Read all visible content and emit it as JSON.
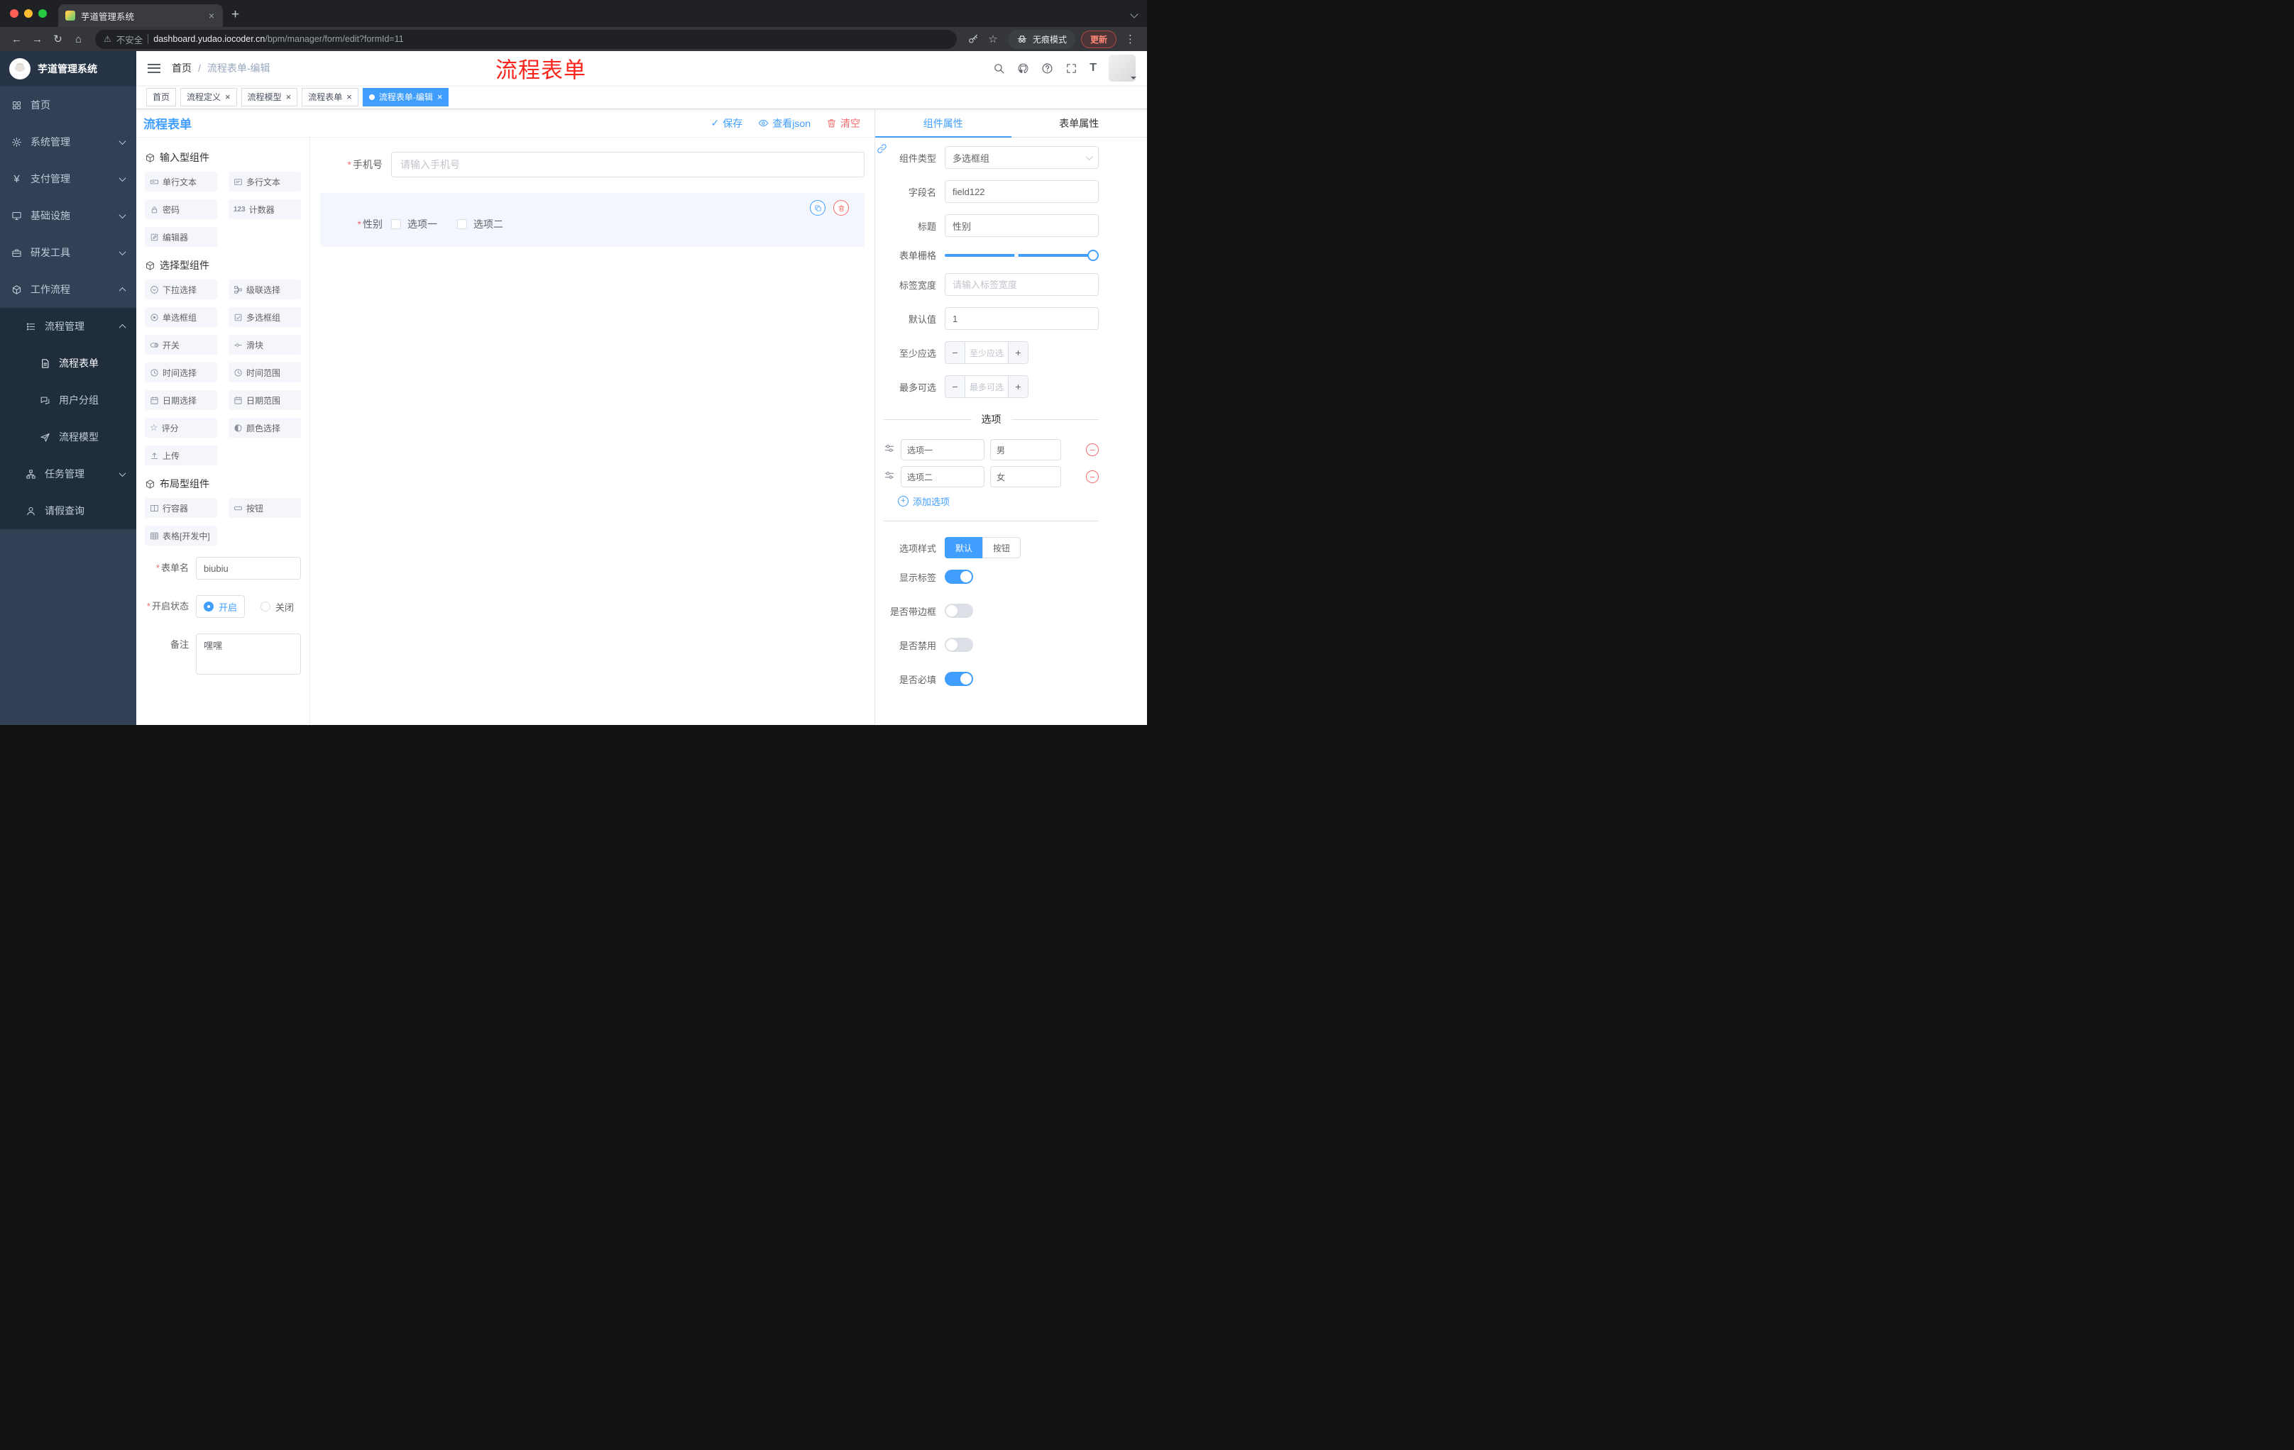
{
  "colors": {
    "accent": "#409eff",
    "danger": "#f56c6c",
    "sidebar_bg": "#304156",
    "sidebar_submenu_bg": "#1f2d3d",
    "annotation": "#fa251c"
  },
  "icons": {
    "close": "×",
    "new_tab": "+",
    "back": "←",
    "forward": "→",
    "reload": "↻",
    "home": "⌂",
    "warning": "⚠",
    "star": "☆",
    "menu_dots": "⋮",
    "check": "✓",
    "breadcrumb_separator": "/",
    "required_mark": "*",
    "minus": "−",
    "plus": "+",
    "yen": "¥",
    "counter": "123",
    "rate_star": "☆",
    "font_size": "T"
  },
  "browser": {
    "tab_title": "芋道管理系统",
    "security_label": "不安全",
    "url_domain": "dashboard.yudao.iocoder.cn",
    "url_path": "/bpm/manager/form/edit?formId=11",
    "incognito_label": "无痕模式",
    "update_label": "更新"
  },
  "annotation": {
    "text": "流程表单"
  },
  "sidebar": {
    "logo_title": "芋道管理系统",
    "items": [
      {
        "label": "首页"
      },
      {
        "label": "系统管理"
      },
      {
        "label": "支付管理"
      },
      {
        "label": "基础设施"
      },
      {
        "label": "研发工具"
      },
      {
        "label": "工作流程"
      },
      {
        "label": "流程管理"
      },
      {
        "label": "流程表单"
      },
      {
        "label": "用户分组"
      },
      {
        "label": "流程模型"
      },
      {
        "label": "任务管理"
      },
      {
        "label": "请假查询"
      }
    ]
  },
  "header": {
    "breadcrumb": {
      "home": "首页",
      "current": "流程表单-编辑"
    }
  },
  "tags": [
    {
      "label": "首页"
    },
    {
      "label": "流程定义"
    },
    {
      "label": "流程模型"
    },
    {
      "label": "流程表单"
    },
    {
      "label": "流程表单-编辑"
    }
  ],
  "designer": {
    "title": "流程表单",
    "actions": {
      "save": "保存",
      "view_json": "查看json",
      "clear": "清空"
    },
    "palette": {
      "groups": [
        {
          "title": "输入型组件",
          "items": [
            "单行文本",
            "多行文本",
            "密码",
            "计数器",
            "编辑器"
          ]
        },
        {
          "title": "选择型组件",
          "items": [
            "下拉选择",
            "级联选择",
            "单选框组",
            "多选框组",
            "开关",
            "滑块",
            "时间选择",
            "时间范围",
            "日期选择",
            "日期范围",
            "评分",
            "颜色选择",
            "上传"
          ]
        },
        {
          "title": "布局型组件",
          "items": [
            "行容器",
            "按钮",
            "表格[开发中]"
          ]
        }
      ]
    },
    "form_meta": {
      "name_label": "表单名",
      "name_value": "biubiu",
      "status_label": "开启状态",
      "status_on": "开启",
      "status_off": "关闭",
      "remark_label": "备注",
      "remark_value": "嘿嘿"
    },
    "canvas": {
      "phone": {
        "label": "手机号",
        "placeholder": "请输入手机号"
      },
      "gender": {
        "label": "性别",
        "option1": "选项一",
        "option2": "选项二"
      }
    },
    "props": {
      "tab_component": "组件属性",
      "tab_form": "表单属性",
      "component_type_label": "组件类型",
      "component_type_value": "多选框组",
      "field_name_label": "字段名",
      "field_name_value": "field122",
      "title_label": "标题",
      "title_value": "性别",
      "grid_label": "表单栅格",
      "label_width_label": "标签宽度",
      "label_width_placeholder": "请输入标签宽度",
      "default_label": "默认值",
      "default_value": "1",
      "min_label": "至少应选",
      "min_placeholder": "至少应选",
      "max_label": "最多可选",
      "max_placeholder": "最多可选",
      "options_title": "选项",
      "options": [
        {
          "label": "选项一",
          "value": "男"
        },
        {
          "label": "选项二",
          "value": "女"
        }
      ],
      "add_option": "添加选项",
      "style_label": "选项样式",
      "style_default": "默认",
      "style_button": "按钮",
      "show_label": "显示标签",
      "with_border": "是否带边框",
      "disabled": "是否禁用",
      "required": "是否必填"
    }
  }
}
